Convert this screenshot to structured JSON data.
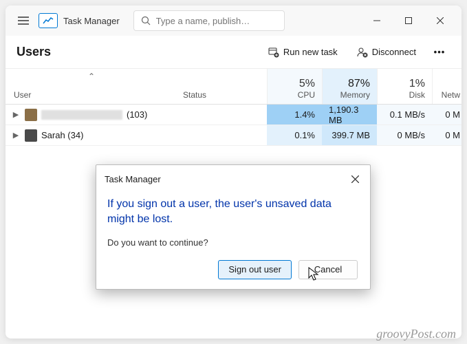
{
  "app": {
    "title": "Task Manager"
  },
  "search": {
    "placeholder": "Type a name, publish…"
  },
  "toolbar": {
    "page_title": "Users",
    "run_new_task": "Run new task",
    "disconnect": "Disconnect"
  },
  "columns": {
    "user": "User",
    "status": "Status",
    "cpu": {
      "pct": "5%",
      "label": "CPU"
    },
    "memory": {
      "pct": "87%",
      "label": "Memory"
    },
    "disk": {
      "pct": "1%",
      "label": "Disk"
    },
    "network": "Netw"
  },
  "rows": [
    {
      "name_suffix": "(103)",
      "status": "",
      "cpu": "1.4%",
      "memory": "1,190.3 MB",
      "disk": "0.1 MB/s",
      "network": "0 M"
    },
    {
      "name": "Sarah (34)",
      "status": "",
      "cpu": "0.1%",
      "memory": "399.7 MB",
      "disk": "0 MB/s",
      "network": "0 M"
    }
  ],
  "dialog": {
    "title": "Task Manager",
    "main": "If you sign out a user, the user's unsaved data might be lost.",
    "sub": "Do you want to continue?",
    "primary": "Sign out user",
    "secondary": "Cancel"
  },
  "watermark": "groovyPost.com"
}
